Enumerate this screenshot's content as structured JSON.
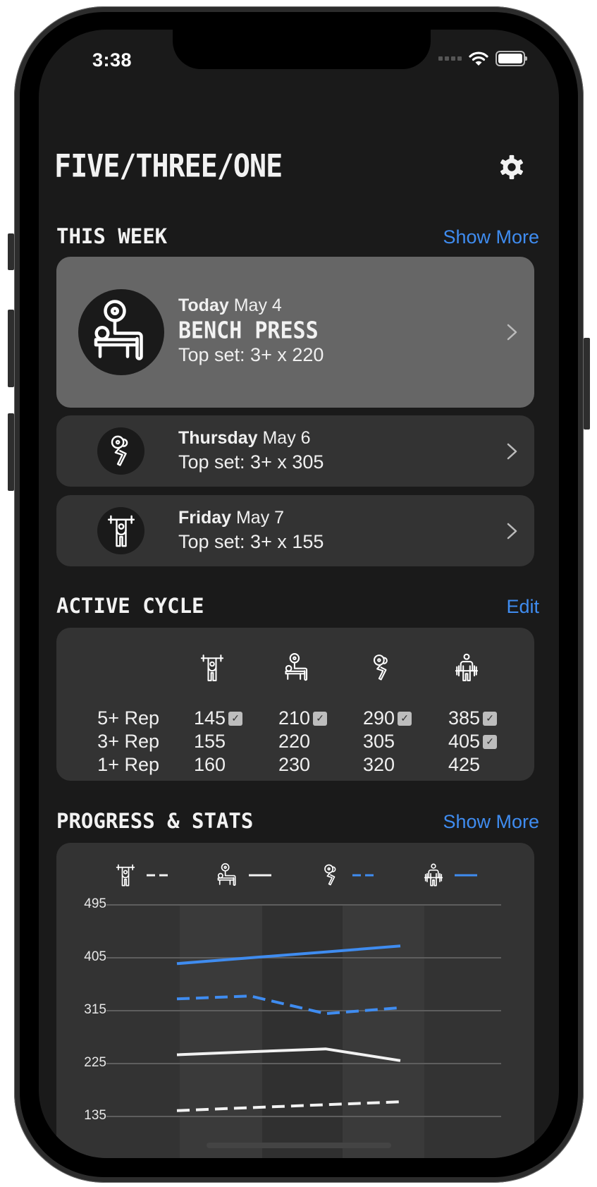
{
  "status_bar": {
    "time": "3:38",
    "wifi_icon": "wifi-icon",
    "battery_icon": "battery-icon"
  },
  "header": {
    "title": "FIVE/THREE/ONE",
    "settings_icon": "gear-icon"
  },
  "this_week": {
    "title": "THIS WEEK",
    "link": "Show More",
    "workouts": [
      {
        "day": "Today",
        "date": "May 4",
        "name": "BENCH PRESS",
        "top_set": "Top set: 3+ x 220",
        "icon": "bench-press-icon",
        "highlighted": true
      },
      {
        "day": "Thursday",
        "date": "May 6",
        "name": "",
        "top_set": "Top set: 3+ x 305",
        "icon": "squat-icon",
        "highlighted": false
      },
      {
        "day": "Friday",
        "date": "May 7",
        "name": "",
        "top_set": "Top set: 3+ x 155",
        "icon": "overhead-press-icon",
        "highlighted": false
      }
    ]
  },
  "active_cycle": {
    "title": "ACTIVE CYCLE",
    "link": "Edit",
    "lifts": [
      "overhead-press-icon",
      "bench-press-icon",
      "squat-icon",
      "deadlift-icon"
    ],
    "rows": [
      {
        "label": "5+ Rep",
        "values": [
          "145",
          "210",
          "290",
          "385"
        ],
        "completed": [
          true,
          true,
          true,
          true
        ]
      },
      {
        "label": "3+ Rep",
        "values": [
          "155",
          "220",
          "305",
          "405"
        ],
        "completed": [
          false,
          false,
          false,
          true
        ]
      },
      {
        "label": "1+ Rep",
        "values": [
          "160",
          "230",
          "320",
          "425"
        ],
        "completed": [
          false,
          false,
          false,
          false
        ]
      }
    ]
  },
  "progress": {
    "title": "PROGRESS & STATS",
    "link": "Show More"
  },
  "colors": {
    "accent": "#3f8cf0",
    "white_series": "#f2f2f2",
    "background": "#1a1a1a",
    "card": "#333333",
    "card_highlight": "#666666"
  },
  "chart_data": {
    "type": "line",
    "title": "",
    "xlabel": "",
    "ylabel": "",
    "x": [
      1,
      2,
      3,
      4
    ],
    "y_ticks": [
      135,
      225,
      315,
      405,
      495
    ],
    "ylim": [
      135,
      495
    ],
    "grid": true,
    "legend": "top",
    "series": [
      {
        "name": "Overhead Press",
        "icon": "overhead-press-icon",
        "color": "#f2f2f2",
        "style": "dashed",
        "values": [
          145,
          150,
          155,
          160
        ]
      },
      {
        "name": "Bench Press",
        "icon": "bench-press-icon",
        "color": "#f2f2f2",
        "style": "solid",
        "values": [
          240,
          245,
          250,
          230
        ]
      },
      {
        "name": "Squat",
        "icon": "squat-icon",
        "color": "#3f8cf0",
        "style": "dashed",
        "values": [
          335,
          340,
          310,
          320
        ]
      },
      {
        "name": "Deadlift",
        "icon": "deadlift-icon",
        "color": "#3f8cf0",
        "style": "solid",
        "values": [
          395,
          405,
          415,
          425
        ]
      }
    ]
  }
}
